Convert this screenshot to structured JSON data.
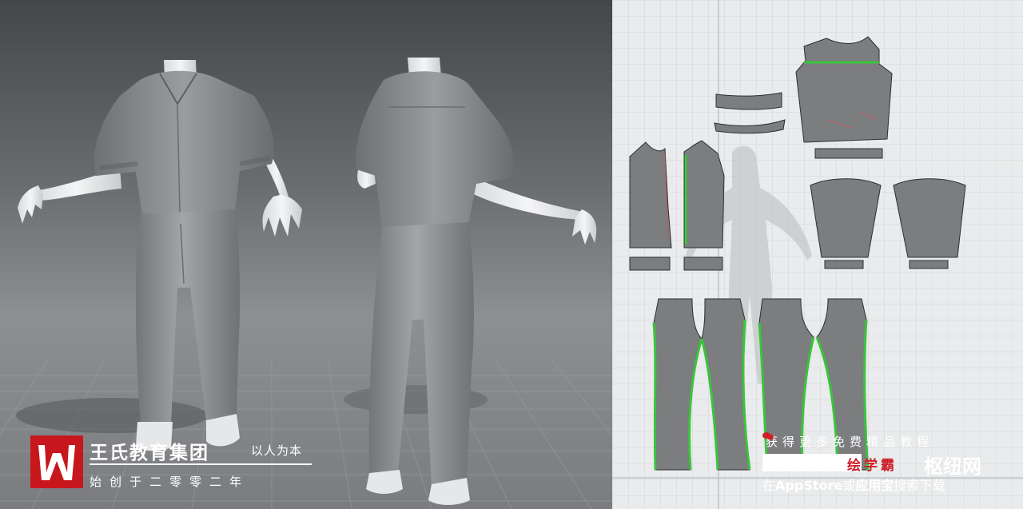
{
  "brand": {
    "name": "王氏教育集团",
    "slogan": "以人为本",
    "tagline": "始创于二零零二年",
    "logo_text": "W",
    "logo_color": "#c8161d"
  },
  "promo": {
    "line1": "获得更多免费精品教程",
    "app_name": "绘学霸",
    "site_name": "枢纽网",
    "line3_prefix": "在",
    "line3_appstore": "AppStore",
    "line3_or": "或",
    "line3_store": "应用宝",
    "line3_suffix": "搜索下载",
    "accent_color": "#cf1f28"
  },
  "viewport3d": {
    "views": [
      "front",
      "back"
    ],
    "grid": true
  },
  "pattern2d": {
    "pieces": [
      "collar-band",
      "collar",
      "back-yoke",
      "back-body",
      "left-front",
      "right-front",
      "cuff",
      "sleeve-left",
      "sleeve-right",
      "front-pant",
      "back-pant"
    ],
    "highlight_color": "#3bc43b"
  }
}
